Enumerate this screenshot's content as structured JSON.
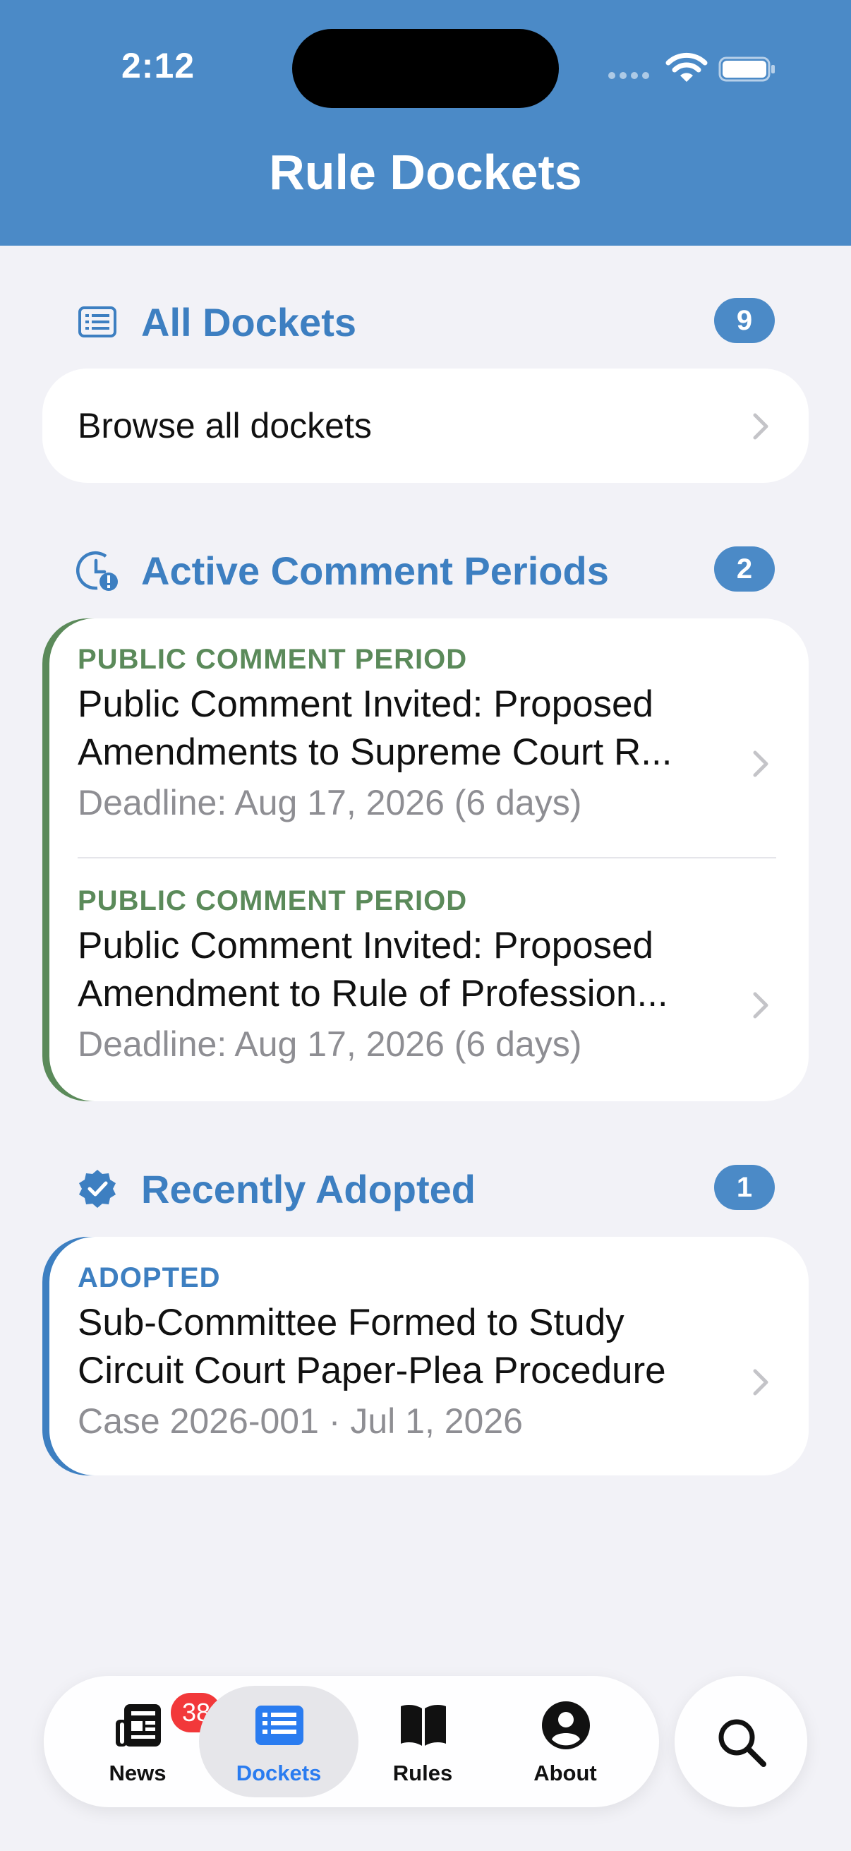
{
  "status_bar": {
    "time": "2:12"
  },
  "header": {
    "title": "Rule Dockets"
  },
  "sections": {
    "all": {
      "title": "All Dockets",
      "count": "9",
      "browse_label": "Browse all dockets"
    },
    "active": {
      "title": "Active Comment Periods",
      "count": "2",
      "items": [
        {
          "kind": "PUBLIC COMMENT PERIOD",
          "title_line1": "Public Comment Invited: Proposed",
          "title_line2": "Amendments to Supreme Court R...",
          "subtitle": "Deadline: Aug 17, 2026 (6 days)"
        },
        {
          "kind": "PUBLIC COMMENT PERIOD",
          "title_line1": "Public Comment Invited: Proposed",
          "title_line2": "Amendment to Rule of Profession...",
          "subtitle": "Deadline: Aug 17, 2026 (6 days)"
        }
      ]
    },
    "adopted": {
      "title": "Recently Adopted",
      "count": "1",
      "items": [
        {
          "kind": "ADOPTED",
          "title_line1": "Sub-Committee Formed to Study",
          "title_line2": "Circuit Court Paper-Plea Procedure",
          "subtitle": "Case 2026-001 · Jul 1, 2026"
        }
      ]
    }
  },
  "tabbar": {
    "tabs": [
      {
        "label": "News",
        "badge": "38",
        "icon": "newspaper-icon"
      },
      {
        "label": "Dockets",
        "icon": "list-icon",
        "selected": true
      },
      {
        "label": "Rules",
        "icon": "book-icon"
      },
      {
        "label": "About",
        "icon": "person-circle-icon"
      }
    ],
    "search_icon": "magnifier-icon"
  },
  "colors": {
    "header_bg": "#4b8ac7",
    "section_title": "#3d7fc1",
    "comment_green": "#5b8a5a",
    "selected_tab": "#2a7cf0",
    "badge_red": "#f2383a"
  }
}
